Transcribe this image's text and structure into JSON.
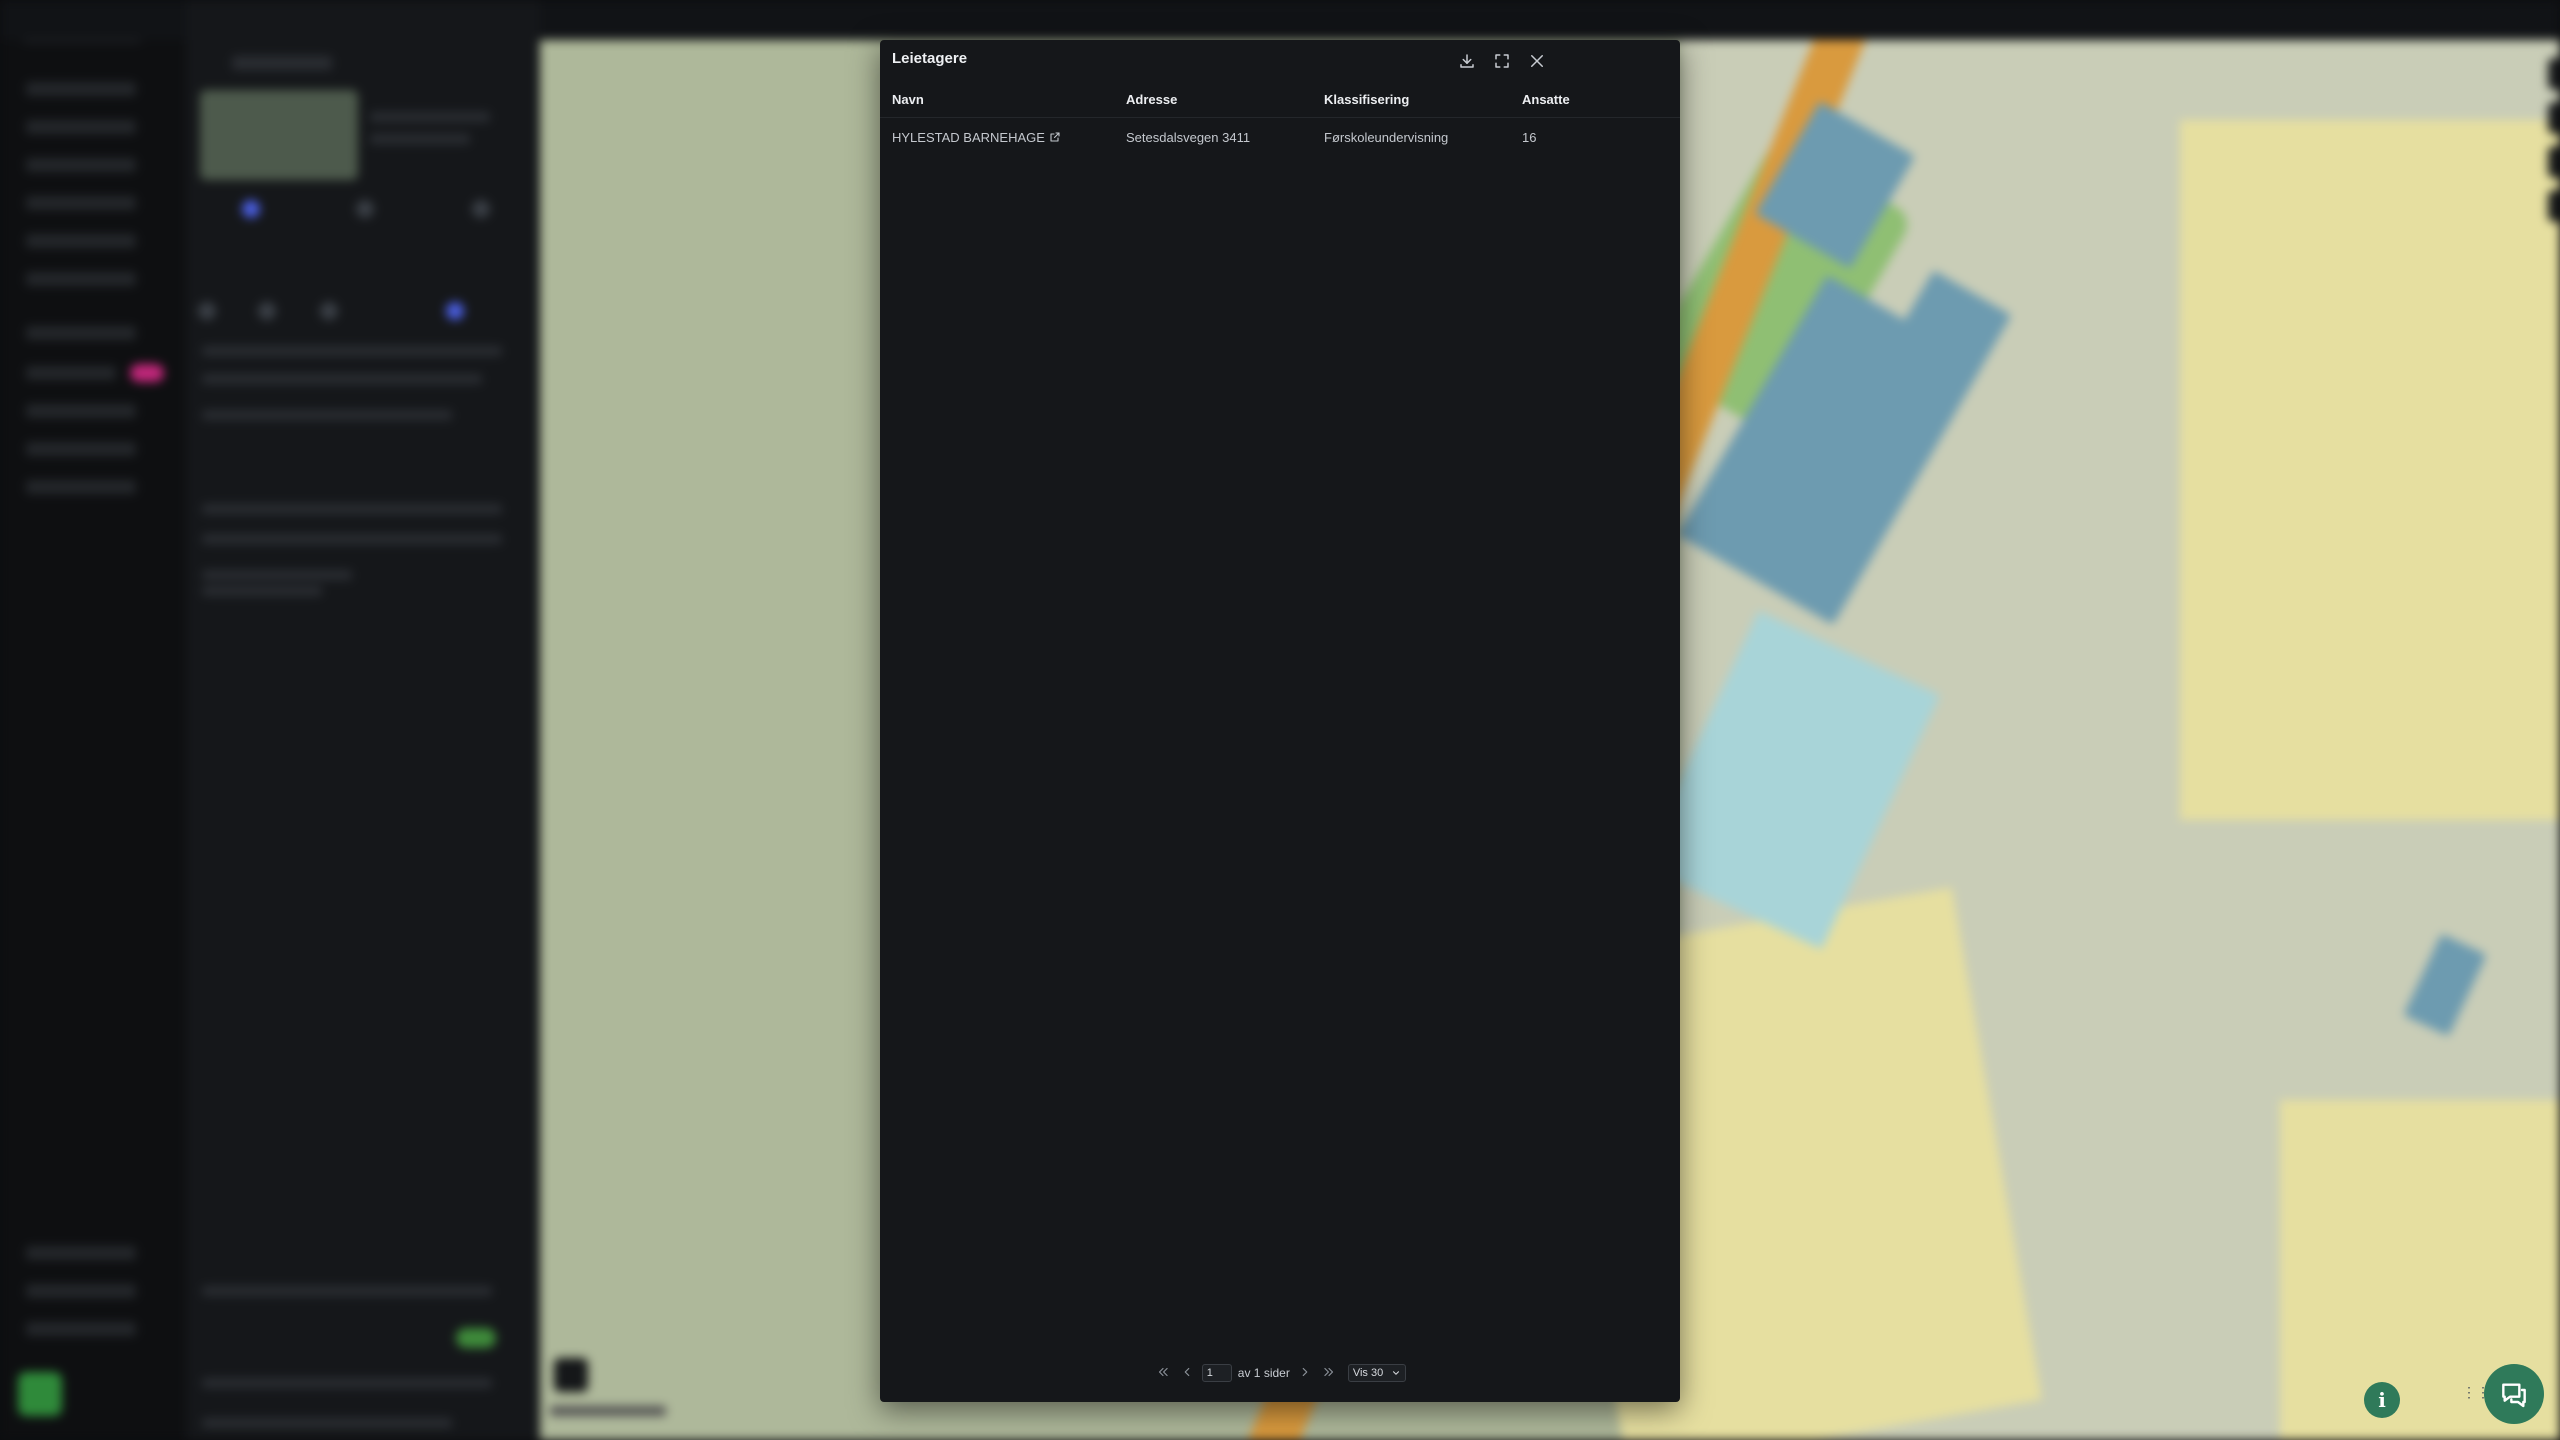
{
  "modal": {
    "title": "Leietagere",
    "columns": [
      "Navn",
      "Adresse",
      "Klassifisering",
      "Ansatte"
    ],
    "rows": [
      {
        "navn": "HYLESTAD BARNEHAGE",
        "adresse": "Setesdalsvegen 3411",
        "klassifisering": "Førskoleundervisning",
        "ansatte": "16"
      }
    ],
    "pagination": {
      "current_page": "1",
      "of_text": "av 1 sider",
      "page_size_label": "Vis 30"
    }
  },
  "colors": {
    "modal_bg": "#15171a",
    "accent_green": "#2f7a5a",
    "text": "#c4c8ce"
  },
  "icons": {
    "download": "download-icon",
    "expand": "expand-icon",
    "close": "close-icon",
    "external_link": "external-link-icon",
    "first_page": "chevrons-left-icon",
    "prev_page": "chevron-left-icon",
    "next_page": "chevron-right-icon",
    "last_page": "chevrons-right-icon",
    "info": "info-icon",
    "chat": "chat-icon",
    "drag": "drag-handle-icon"
  }
}
